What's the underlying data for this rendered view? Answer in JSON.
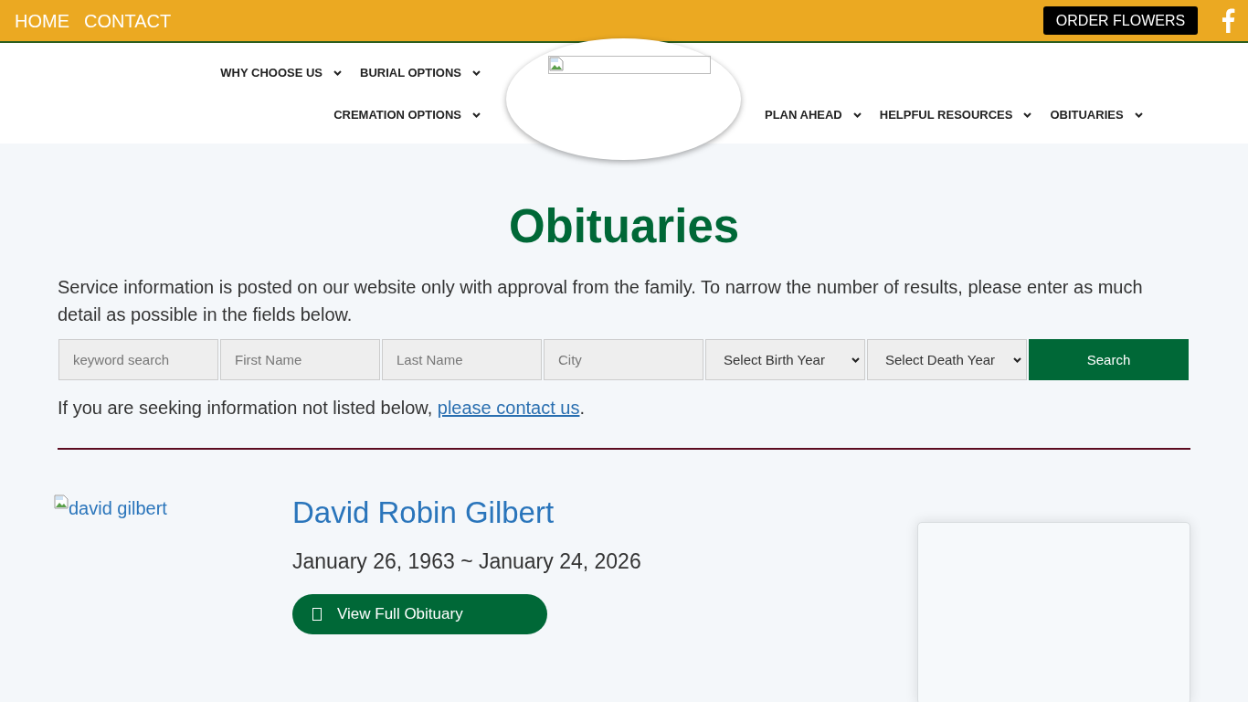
{
  "top_bar": {
    "links": [
      "HOME",
      "CONTACT"
    ],
    "order_button": "ORDER FLOWERS"
  },
  "nav": {
    "left_rows": [
      {
        "items": [
          "WHY CHOOSE US",
          "BURIAL OPTIONS"
        ]
      },
      {
        "items": [
          "CREMATION OPTIONS"
        ]
      }
    ],
    "right_items": [
      "PLAN AHEAD",
      "HELPFUL RESOURCES",
      "OBITUARIES"
    ]
  },
  "page": {
    "title": "Obituaries",
    "intro": "Service information is posted on our website only with approval from the family. To narrow the number of results, please enter as much detail as possible in the fields below.",
    "search": {
      "fields": [
        {
          "kind": "text",
          "placeholder": "keyword search"
        },
        {
          "kind": "text",
          "placeholder": "First Name"
        },
        {
          "kind": "text",
          "placeholder": "Last Name"
        },
        {
          "kind": "text",
          "placeholder": "City"
        },
        {
          "kind": "select",
          "value": "Select Birth Year"
        },
        {
          "kind": "select",
          "value": "Select Death Year"
        }
      ],
      "button": "Search"
    },
    "note": {
      "text": "If you are seeking information not listed below,",
      "link": "please contact us",
      "after": "."
    }
  },
  "obituaries": [
    {
      "photo_alt": "david gilbert",
      "name": "David Robin Gilbert",
      "dates": "January 26, 1963 ~ January 24, 2026",
      "button": "View Full Obituary"
    }
  ]
}
